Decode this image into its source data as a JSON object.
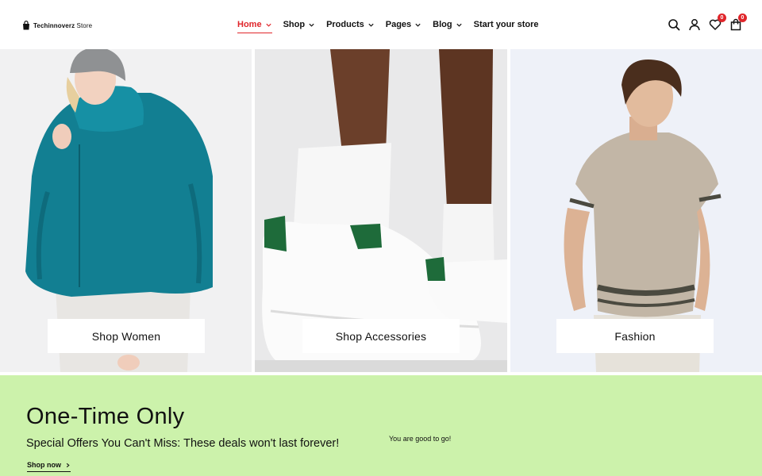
{
  "header": {
    "logo": {
      "bold": "Techinnoverz",
      "light": "Store",
      "icon": "shopping-bag-icon"
    },
    "nav": [
      {
        "label": "Home",
        "active": true,
        "has_dropdown": true
      },
      {
        "label": "Shop",
        "active": false,
        "has_dropdown": true
      },
      {
        "label": "Products",
        "active": false,
        "has_dropdown": true
      },
      {
        "label": "Pages",
        "active": false,
        "has_dropdown": true
      },
      {
        "label": "Blog",
        "active": false,
        "has_dropdown": true
      },
      {
        "label": "Start your store",
        "active": false,
        "has_dropdown": false
      }
    ],
    "actions": {
      "search_icon": "search-icon",
      "account_icon": "user-icon",
      "wishlist_icon": "heart-icon",
      "wishlist_count": "0",
      "cart_icon": "bag-icon",
      "cart_count": "0"
    },
    "accent_color": "#e0262b"
  },
  "hero": {
    "panels": [
      {
        "cta": "Shop Women"
      },
      {
        "cta": "Shop Accessories"
      },
      {
        "cta": "Fashion"
      }
    ]
  },
  "promo": {
    "title": "One-Time Only",
    "subtitle": "Special Offers You Can't Miss: These deals won't last forever!",
    "link": "Shop now",
    "note": "You are good to go!",
    "background": "#ccf2ab"
  }
}
